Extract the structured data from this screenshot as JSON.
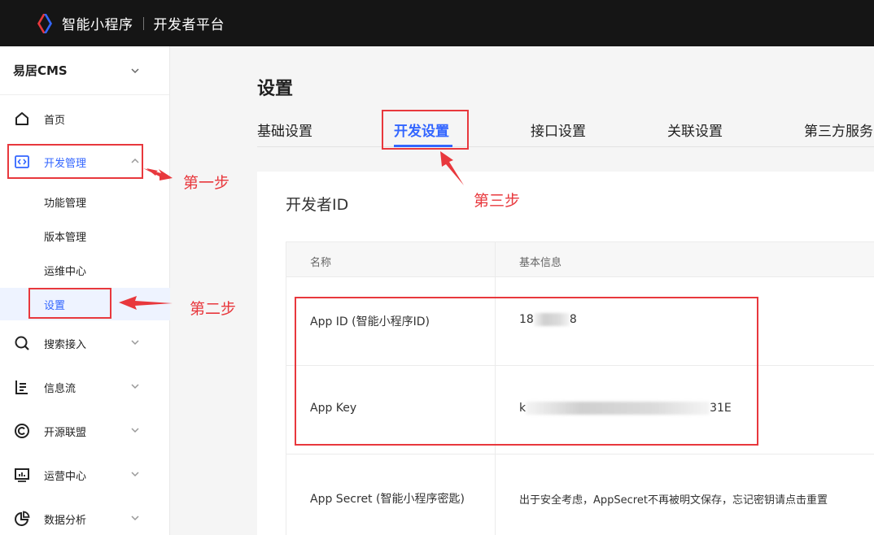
{
  "header": {
    "brand": "智能小程序",
    "platform": "开发者平台"
  },
  "sidebar": {
    "project": "易居CMS",
    "items": [
      {
        "label": "首页",
        "icon": "home-icon"
      },
      {
        "label": "开发管理",
        "icon": "code-icon"
      },
      {
        "label": "搜索接入",
        "icon": "search-icon"
      },
      {
        "label": "信息流",
        "icon": "list-icon"
      },
      {
        "label": "开源联盟",
        "icon": "alliance-icon"
      },
      {
        "label": "运营中心",
        "icon": "chart-icon"
      },
      {
        "label": "数据分析",
        "icon": "pie-icon"
      }
    ],
    "sub_items": [
      "功能管理",
      "版本管理",
      "运维中心",
      "设置"
    ]
  },
  "main": {
    "title": "设置",
    "tabs": [
      "基础设置",
      "开发设置",
      "接口设置",
      "关联设置",
      "第三方服务"
    ],
    "active_tab": "开发设置",
    "section_title": "开发者ID",
    "table": {
      "headers": [
        "名称",
        "基本信息"
      ],
      "rows": [
        {
          "name": "App ID (智能小程序ID)",
          "value_prefix": "18",
          "value_suffix": "8"
        },
        {
          "name": "App Key",
          "value_prefix": "k",
          "value_suffix": "31E"
        },
        {
          "name": "App Secret (智能小程序密匙)",
          "note": "出于安全考虑，AppSecret不再被明文保存，忘记密钥请点击重置"
        }
      ]
    }
  },
  "annotations": {
    "step1": "第一步",
    "step2": "第二步",
    "step3": "第三步",
    "color": "#e8383d"
  },
  "colors": {
    "accent": "#3366ff",
    "topbar": "#151515"
  }
}
